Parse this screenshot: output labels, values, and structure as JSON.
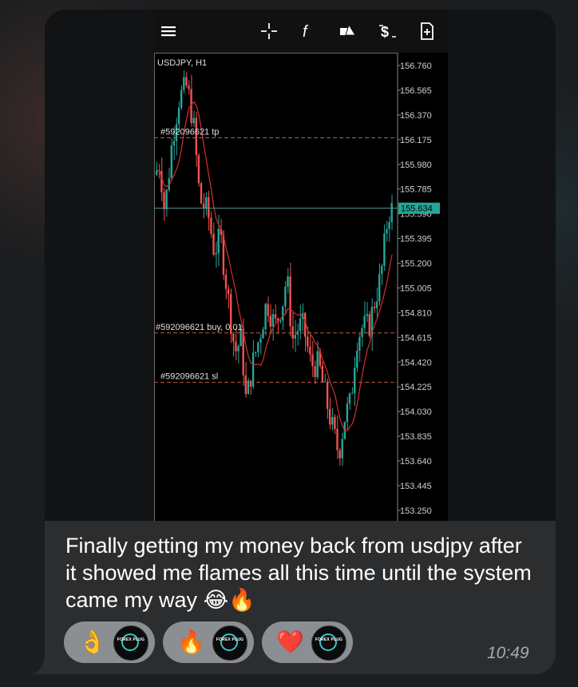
{
  "message": {
    "caption": "Finally getting my money back from usdjpy after it showed me flames all this time until the system came my way",
    "caption_emojis": "😂🔥",
    "time": "10:49"
  },
  "reactions": [
    {
      "emoji": "👌",
      "avatar_label": "FOREX PLUG"
    },
    {
      "emoji": "🔥",
      "avatar_label": "FOREX PLUG"
    },
    {
      "emoji": "❤️",
      "avatar_label": "FOREX PLUG"
    }
  ],
  "toolbar": {
    "icons": [
      "menu-icon",
      "crosshair-icon",
      "indicator-f-icon",
      "objects-icon",
      "trade-icon",
      "new-document-icon"
    ]
  },
  "chart_data": {
    "type": "candlestick",
    "symbol_label": "USDJPY, H1",
    "current_price": "155.634",
    "y_ticks": [
      "156.760",
      "156.565",
      "156.370",
      "156.175",
      "155.980",
      "155.785",
      "155.590",
      "155.395",
      "155.200",
      "155.005",
      "154.810",
      "154.615",
      "154.420",
      "154.225",
      "154.030",
      "153.835",
      "153.640",
      "153.445",
      "153.250"
    ],
    "ylim": [
      153.2,
      156.85
    ],
    "order_lines": [
      {
        "label": "#592096621 tp",
        "price": 156.19
      },
      {
        "label": "#592096621 buy, 0.01",
        "price": 154.65
      },
      {
        "label": "#592096621 sl",
        "price": 154.26
      }
    ],
    "colors": {
      "up": "#26a69a",
      "down": "#ef5350",
      "ma": "#d32f2f",
      "bg": "#000000"
    }
  }
}
